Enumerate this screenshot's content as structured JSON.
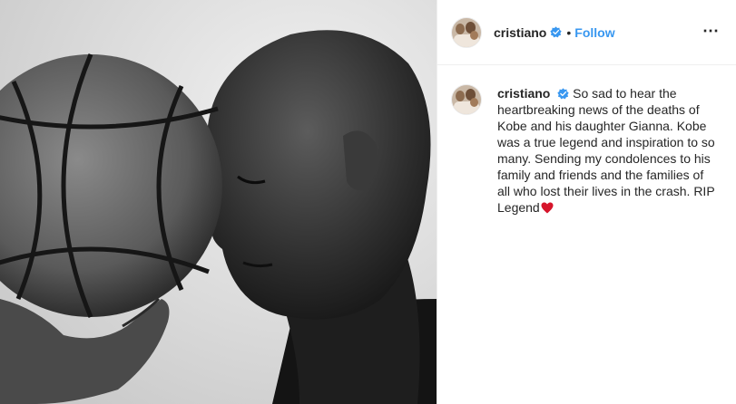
{
  "post": {
    "author": {
      "username": "cristiano",
      "verified": true,
      "follow_label": "Follow",
      "separator": "•"
    },
    "more_options_icon": "more-dots-icon",
    "caption": {
      "username": "cristiano",
      "text": "So sad to hear the heartbreaking news of the deaths of Kobe and his daughter Gianna. Kobe was a true legend and inspiration to so many. Sending my condolences to his family and friends and the families of all who lost their lives in the crash. RIP Legend",
      "emoji": "red-heart-icon"
    },
    "photo": {
      "subject": "black-and-white portrait with basketball"
    },
    "colors": {
      "follow_blue": "#3897f0",
      "verified_blue": "#3897f0",
      "heart_red": "#d6152b"
    }
  }
}
